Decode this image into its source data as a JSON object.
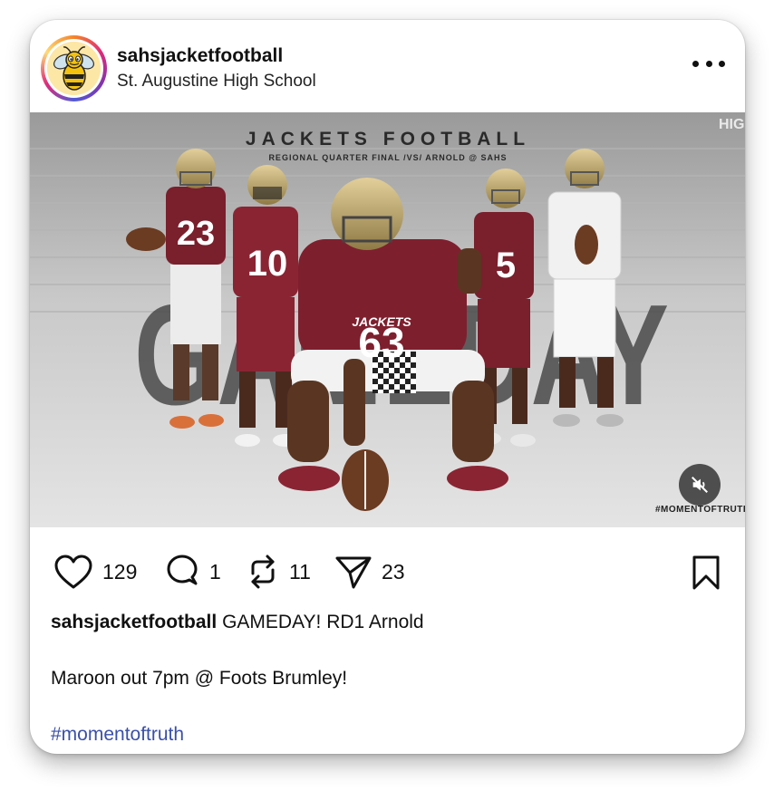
{
  "post": {
    "username": "sahsjacketfootball",
    "location": "St. Augustine High School",
    "avatar_icon": "yellow-jacket-mascot-icon",
    "more_icon": "more-options-icon"
  },
  "media": {
    "title": "JACKETS FOOTBALL",
    "subtitle": "REGIONAL QUARTER FINAL /VS/ ARNOLD @ SAHS",
    "big_word": "GAMEDAY",
    "hashtag": "#MOMENTOFTRUTH",
    "mute_icon": "speaker-muted-icon",
    "jersey_numbers": [
      "23",
      "10",
      "63",
      "5"
    ],
    "jersey_text": "JACKETS",
    "colors": {
      "maroon": "#7a1f2c",
      "gold": "#b8a06a",
      "accent": "#3a50a8"
    }
  },
  "actions": {
    "likes": "129",
    "comments": "1",
    "reposts": "11",
    "shares": "23"
  },
  "caption": {
    "username": "sahsjacketfootball",
    "line1": "GAMEDAY! RD1 Arnold",
    "line2": "Maroon out 7pm @ Foots Brumley!",
    "tag": "#momentoftruth"
  }
}
